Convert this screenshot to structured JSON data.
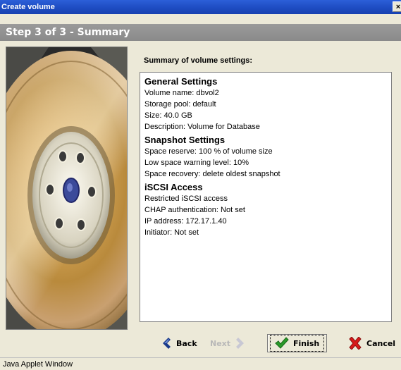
{
  "window": {
    "title": "Create volume",
    "close_glyph": "×"
  },
  "step_header": "Step 3 of 3 - Summary",
  "summary": {
    "title": "Summary of volume settings:",
    "sections": [
      {
        "heading": "General Settings",
        "lines": [
          "Volume name:  dbvol2",
          "Storage pool:  default",
          "Size:  40.0 GB",
          "Description:  Volume for Database"
        ]
      },
      {
        "heading": "Snapshot Settings",
        "lines": [
          "Space reserve:  100 % of volume size",
          "Low space warning level:  10%",
          "Space recovery:  delete oldest snapshot"
        ]
      },
      {
        "heading": "iSCSI Access",
        "lines": [
          "Restricted iSCSI access",
          "CHAP authentication:  Not set",
          "IP address:  172.17.1.40",
          "Initiator:  Not set"
        ]
      }
    ]
  },
  "buttons": {
    "back": "Back",
    "next": "Next",
    "finish": "Finish",
    "cancel": "Cancel"
  },
  "status_bar": "Java Applet Window",
  "icons": {
    "back": "chevron-left-icon",
    "next": "chevron-right-icon",
    "finish": "checkmark-icon",
    "cancel": "x-icon"
  },
  "colors": {
    "titlebar": "#1f4ec4",
    "step_header": "#8f8f8f",
    "dialog_bg": "#ece9d8",
    "finish_green": "#2a9a2a",
    "cancel_red": "#d81a1a",
    "nav_blue": "#1a3a8a"
  }
}
